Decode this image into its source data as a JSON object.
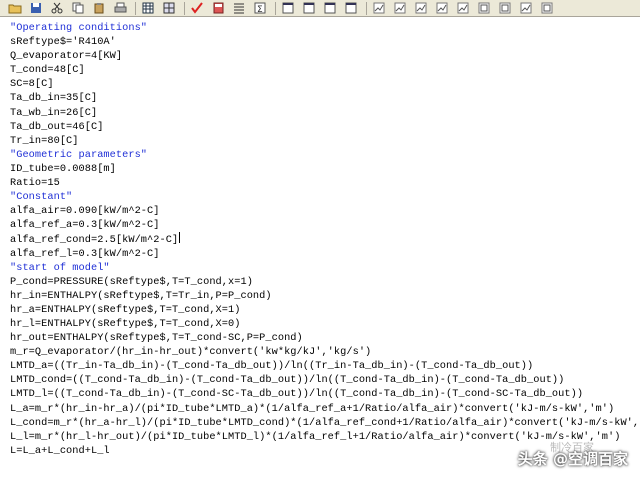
{
  "toolbar": {
    "buttons": [
      "open-icon",
      "save-icon",
      "cut-icon",
      "copy-icon",
      "paste-icon",
      "print-icon",
      "table-icon",
      "grid-icon",
      "check-icon",
      "calculator-icon",
      "list-icon",
      "sum-icon",
      "window-icon",
      "window-icon",
      "window-icon",
      "window-icon",
      "chart-icon",
      "chart-icon",
      "chart-icon",
      "chart-icon",
      "chart-icon",
      "diagram-icon",
      "diagram-icon",
      "chart-icon",
      "diagram-icon"
    ]
  },
  "code": {
    "lines": [
      {
        "text": "\"Operating conditions\"",
        "kind": "comment"
      },
      {
        "text": "sReftype$='R410A'",
        "kind": "code"
      },
      {
        "text": "Q_evaporator=4[KW]",
        "kind": "code"
      },
      {
        "text": "T_cond=48[C]",
        "kind": "code"
      },
      {
        "text": "SC=8[C]",
        "kind": "code"
      },
      {
        "text": "Ta_db_in=35[C]",
        "kind": "code"
      },
      {
        "text": "Ta_wb_in=26[C]",
        "kind": "code"
      },
      {
        "text": "Ta_db_out=46[C]",
        "kind": "code"
      },
      {
        "text": "Tr_in=80[C]",
        "kind": "code"
      },
      {
        "text": "\"Geometric parameters\"",
        "kind": "comment"
      },
      {
        "text": "ID_tube=0.0088[m]",
        "kind": "code"
      },
      {
        "text": "Ratio=15",
        "kind": "code"
      },
      {
        "text": "\"Constant\"",
        "kind": "comment"
      },
      {
        "text": "alfa_air=0.090[kW/m^2-C]",
        "kind": "code"
      },
      {
        "text": "alfa_ref_a=0.3[kW/m^2-C]",
        "kind": "code"
      },
      {
        "text": "alfa_ref_cond=2.5[kW/m^2-C]",
        "kind": "code"
      },
      {
        "text": "alfa_ref_l=0.3[kW/m^2-C]",
        "kind": "code"
      },
      {
        "text": "\"start of model\"",
        "kind": "comment"
      },
      {
        "text": "P_cond=PRESSURE(sReftype$,T=T_cond,x=1)",
        "kind": "code"
      },
      {
        "text": "hr_in=ENTHALPY(sReftype$,T=Tr_in,P=P_cond)",
        "kind": "code"
      },
      {
        "text": "hr_a=ENTHALPY(sReftype$,T=T_cond,X=1)",
        "kind": "code"
      },
      {
        "text": "hr_l=ENTHALPY(sReftype$,T=T_cond,X=0)",
        "kind": "code"
      },
      {
        "text": "hr_out=ENTHALPY(sReftype$,T=T_cond-SC,P=P_cond)",
        "kind": "code"
      },
      {
        "text": "m_r=Q_evaporator/(hr_in-hr_out)*convert('kw*kg/kJ','kg/s')",
        "kind": "code"
      },
      {
        "text": "LMTD_a=((Tr_in-Ta_db_in)-(T_cond-Ta_db_out))/ln((Tr_in-Ta_db_in)-(T_cond-Ta_db_out))",
        "kind": "code"
      },
      {
        "text": "LMTD_cond=((T_cond-Ta_db_in)-(T_cond-Ta_db_out))/ln((T_cond-Ta_db_in)-(T_cond-Ta_db_out))",
        "kind": "code"
      },
      {
        "text": "LMTD_l=((T_cond-Ta_db_in)-(T_cond-SC-Ta_db_out))/ln((T_cond-Ta_db_in)-(T_cond-SC-Ta_db_out))",
        "kind": "code"
      },
      {
        "text": "L_a=m_r*(hr_in-hr_a)/(pi*ID_tube*LMTD_a)*(1/alfa_ref_a+1/Ratio/alfa_air)*convert('kJ-m/s-kW','m')",
        "kind": "code"
      },
      {
        "text": "L_cond=m_r*(hr_a-hr_l)/(pi*ID_tube*LMTD_cond)*(1/alfa_ref_cond+1/Ratio/alfa_air)*convert('kJ-m/s-kW','m')",
        "kind": "code"
      },
      {
        "text": "L_l=m_r*(hr_l-hr_out)/(pi*ID_tube*LMTD_l)*(1/alfa_ref_l+1/Ratio/alfa_air)*convert('kJ-m/s-kW','m')",
        "kind": "code"
      },
      {
        "text": "L=L_a+L_cond+L_l",
        "kind": "code"
      }
    ],
    "caret_line": 15
  },
  "watermark": {
    "text": "头条 @空调百家",
    "faint": "制冷百家"
  }
}
